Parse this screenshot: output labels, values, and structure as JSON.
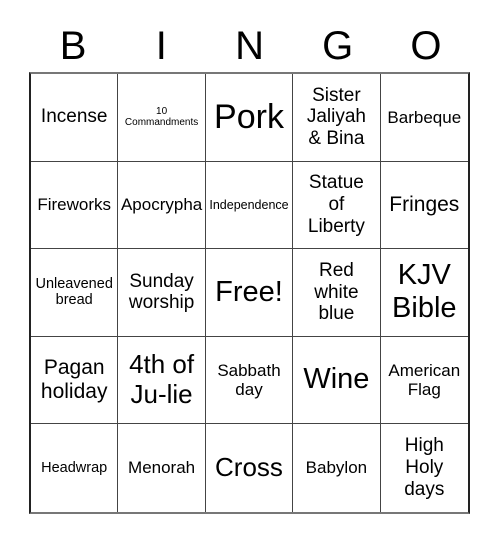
{
  "header": {
    "letters": [
      "B",
      "I",
      "N",
      "G",
      "O"
    ]
  },
  "board": {
    "cells": [
      "Incense",
      "10 Commandments",
      "Pork",
      "Sister Jaliyah & Bina",
      "Barbeque",
      "Fireworks",
      "Apocrypha",
      "Independence",
      "Statue of Liberty",
      "Fringes",
      "Unleavened bread",
      "Sunday worship",
      "Free!",
      "Red white blue",
      "KJV Bible",
      "Pagan holiday",
      "4th of Ju-lie",
      "Sabbath day",
      "Wine",
      "American Flag",
      "Headwrap",
      "Menorah",
      "Cross",
      "Babylon",
      "High Holy days"
    ],
    "free_space_index": 12
  }
}
